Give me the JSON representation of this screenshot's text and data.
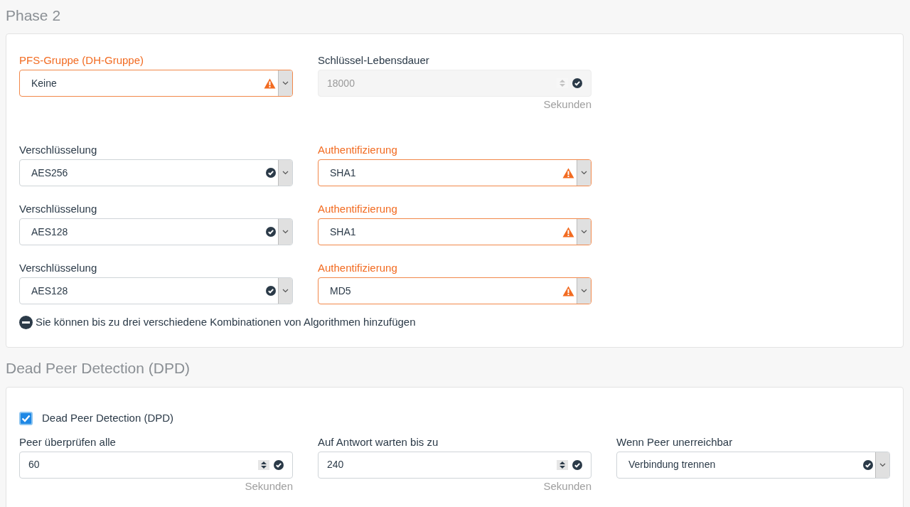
{
  "phase2": {
    "title": "Phase 2",
    "rows": [
      [
        {
          "label": "PFS-Gruppe (DH-Gruppe)",
          "value": "Keine",
          "kind": "select",
          "warning": true,
          "disabled": false
        },
        {
          "label": "Schlüssel-Lebensdauer",
          "value": "18000",
          "kind": "number",
          "warning": false,
          "disabled": true,
          "unit": "Sekunden"
        }
      ],
      [
        {
          "label": "Verschlüsselung",
          "value": "AES256",
          "kind": "select",
          "warning": false,
          "disabled": false
        },
        {
          "label": "Authentifizierung",
          "value": "SHA1",
          "kind": "select",
          "warning": true,
          "disabled": false
        }
      ],
      [
        {
          "label": "Verschlüsselung",
          "value": "AES128",
          "kind": "select",
          "warning": false,
          "disabled": false
        },
        {
          "label": "Authentifizierung",
          "value": "SHA1",
          "kind": "select",
          "warning": true,
          "disabled": false
        }
      ],
      [
        {
          "label": "Verschlüsselung",
          "value": "AES128",
          "kind": "select",
          "warning": false,
          "disabled": false
        },
        {
          "label": "Authentifizierung",
          "value": "MD5",
          "kind": "select",
          "warning": true,
          "disabled": false
        }
      ]
    ],
    "note": "Sie können bis zu drei verschiedene Kombinationen von Algorithmen hinzufügen"
  },
  "dpd": {
    "title": "Dead Peer Detection (DPD)",
    "checkbox": {
      "label": "Dead Peer Detection (DPD)",
      "checked": true
    },
    "fields": [
      {
        "label": "Peer überprüfen alle",
        "value": "60",
        "kind": "number",
        "warning": false,
        "disabled": false,
        "unit": "Sekunden"
      },
      {
        "label": "Auf Antwort warten bis zu",
        "value": "240",
        "kind": "number",
        "warning": false,
        "disabled": false,
        "unit": "Sekunden"
      },
      {
        "label": "Wenn Peer unerreichbar",
        "value": "Verbindung trennen",
        "kind": "select",
        "warning": false,
        "disabled": false
      }
    ]
  }
}
